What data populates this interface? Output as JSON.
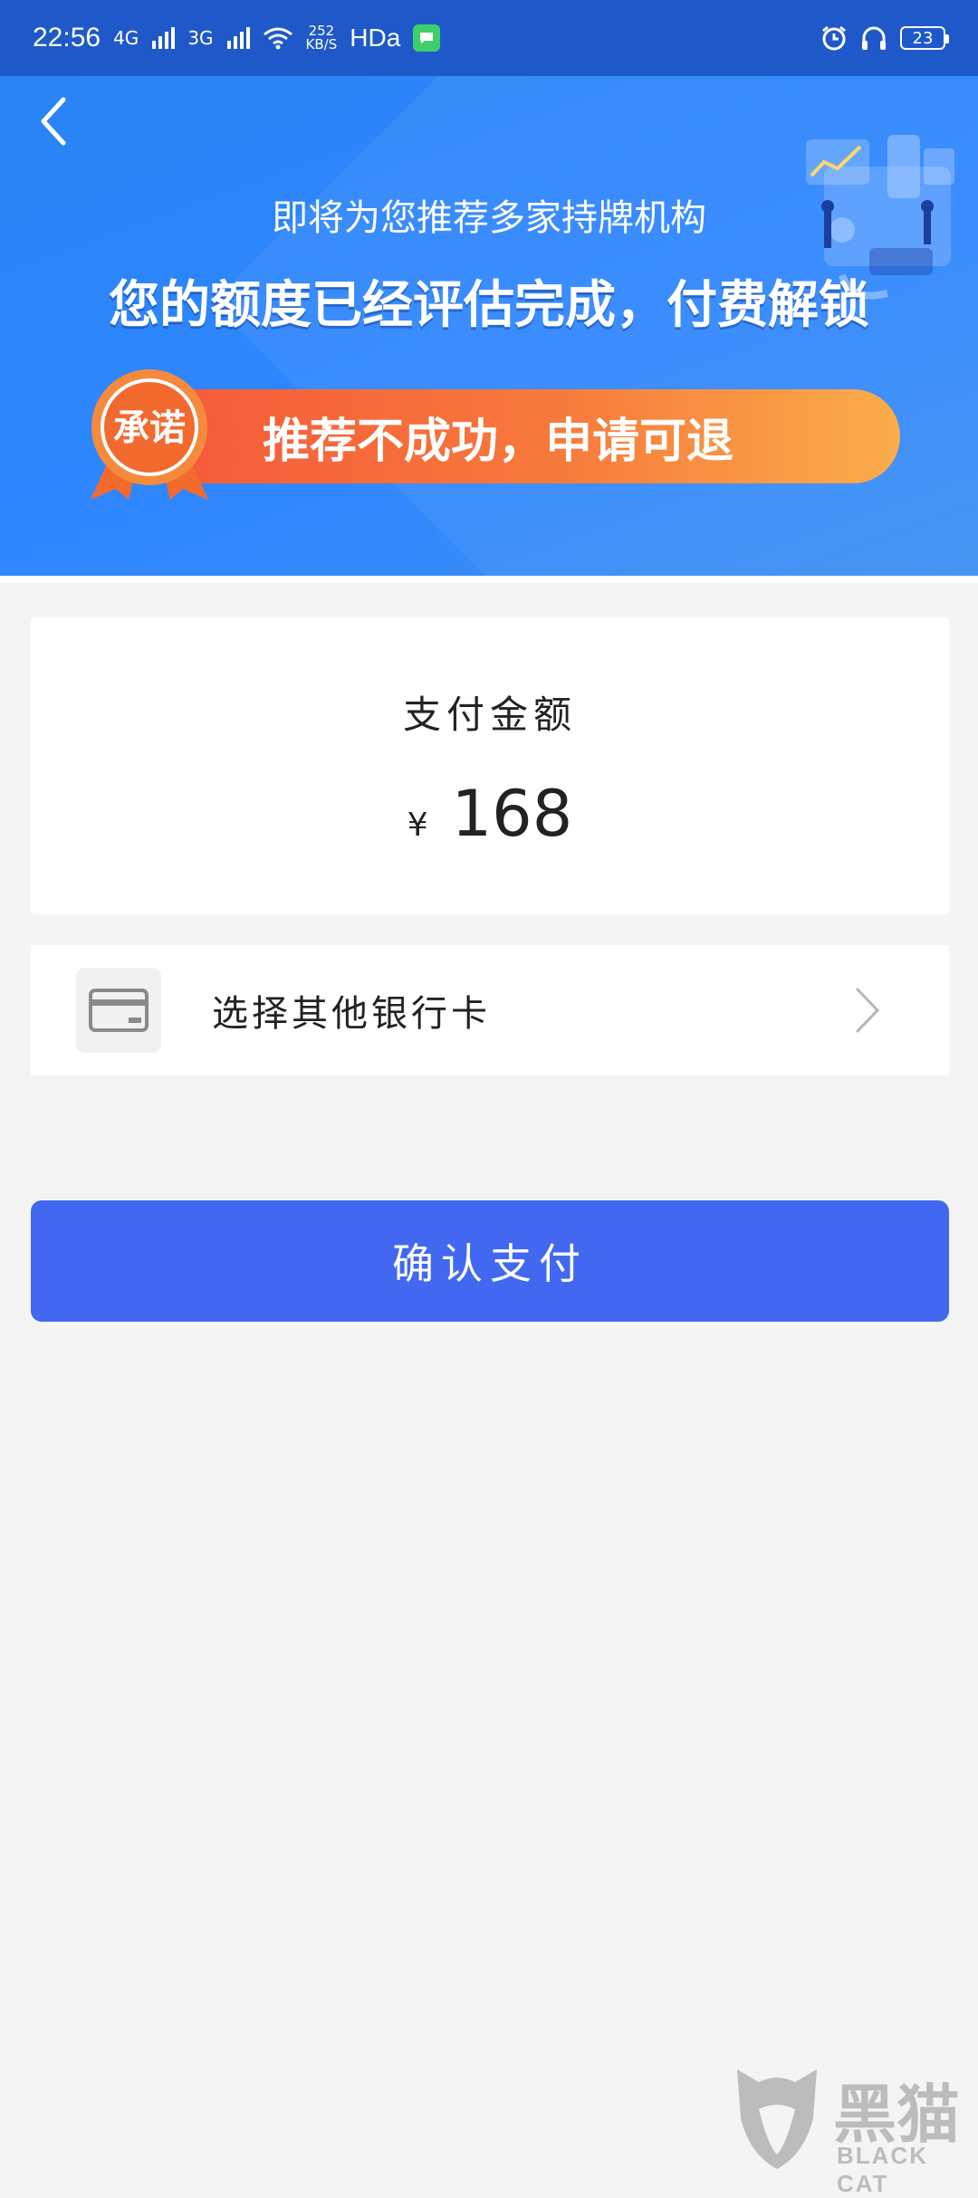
{
  "status_bar": {
    "time": "22:56",
    "network1": "4G",
    "network2": "3G",
    "speed_value": "252",
    "speed_unit": "KB/S",
    "hd": "HDа",
    "battery": "23"
  },
  "banner": {
    "subtitle": "即将为您推荐多家持牌机构",
    "title": "您的额度已经评估完成，付费解锁",
    "seal_text": "承诺",
    "promise": "推荐不成功，申请可退"
  },
  "payment": {
    "label": "支付金额",
    "currency": "¥",
    "amount": "168"
  },
  "card_select": {
    "label": "选择其他银行卡"
  },
  "confirm_button": {
    "label": "确认支付"
  },
  "watermark": {
    "name": "黑猫",
    "sub": "BLACK CAT"
  },
  "colors": {
    "status_bar": "#1f59c9",
    "banner": "#2f86ff",
    "promise_pill_start": "#f5573a",
    "promise_pill_end": "#fbac4a",
    "button": "#4268f1",
    "background": "#f4f4f4"
  }
}
